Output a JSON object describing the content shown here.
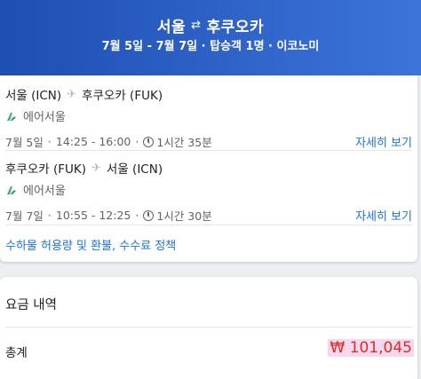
{
  "header": {
    "origin": "서울",
    "destination": "후쿠오카",
    "swap_icon": "⇄",
    "summary": "7월 5일 - 7월 7일 · 탑승객 1명 · 이코노미"
  },
  "segments": [
    {
      "from": "서울 (ICN)",
      "to": "후쿠오카 (FUK)",
      "airline": "에어서울",
      "date": "7월 5일",
      "time": "14:25 - 16:00",
      "duration": "1시간 35분",
      "details_label": "자세히 보기"
    },
    {
      "from": "후쿠오카 (FUK)",
      "to": "서울 (ICN)",
      "airline": "에어서울",
      "date": "7월 7일",
      "time": "10:55 - 12:25",
      "duration": "1시간 30분",
      "details_label": "자세히 보기"
    }
  ],
  "policy_link": "수하물 허용량 및 환불, 수수료 정책",
  "price": {
    "title": "요금 내역",
    "total_label": "총계",
    "total_value": "₩ 101,045"
  },
  "colors": {
    "header_start": "#1e4fb3",
    "header_end": "#3c74da",
    "link": "#1a73e8",
    "price": "#d93025",
    "airline_logo": "#3cb371"
  },
  "icons": {
    "plane": "airplane-icon",
    "clock": "clock-icon",
    "airline_logo": "air-seoul-logo-icon",
    "swap": "swap-arrows-icon"
  }
}
